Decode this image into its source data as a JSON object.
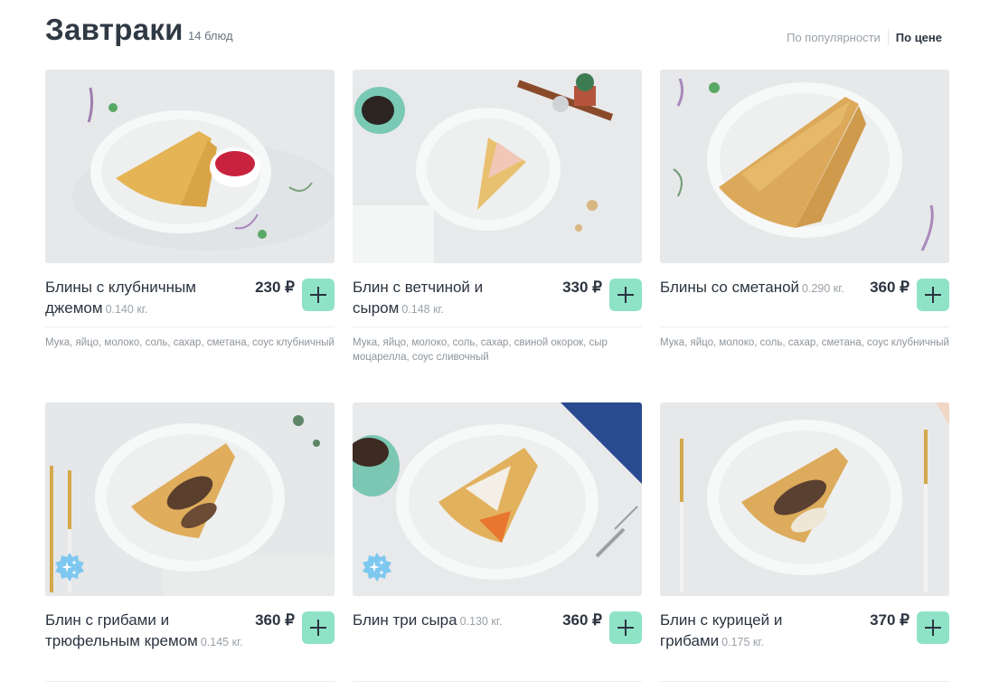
{
  "header": {
    "title": "Завтраки",
    "count": "14 блюд",
    "sort": {
      "popularity": "По популярности",
      "price": "По цене",
      "active": "price"
    }
  },
  "colors": {
    "accent": "#8ee3c6",
    "text": "#2b3440",
    "muted": "#9aa1a8"
  },
  "products": [
    {
      "name": "Блины с клубничным джемом",
      "weight": "0.140 кг.",
      "price": "230 ₽",
      "ingredients": "Мука, яйцо, молоко, соль, сахар, сметана, соус клубничный"
    },
    {
      "name": "Блин с ветчиной и сыром",
      "weight": "0.148 кг.",
      "price": "330 ₽",
      "ingredients": "Мука, яйцо, молоко, соль, сахар, свиной окорок, сыр моцарелла, соус сливочный"
    },
    {
      "name": "Блины со сметаной",
      "weight": "0.290 кг.",
      "price": "360 ₽",
      "ingredients": "Мука, яйцо, молоко, соль, сахар, сметана, соус клубничный"
    },
    {
      "name": "Блин с грибами и трюфельным кремом",
      "weight": "0.145 кг.",
      "price": "360 ₽",
      "ingredients": ""
    },
    {
      "name": "Блин три сыра",
      "weight": "0.130 кг.",
      "price": "360 ₽",
      "ingredients": ""
    },
    {
      "name": "Блин с курицей и грибами",
      "weight": "0.175 кг.",
      "price": "370 ₽",
      "ingredients": ""
    }
  ]
}
